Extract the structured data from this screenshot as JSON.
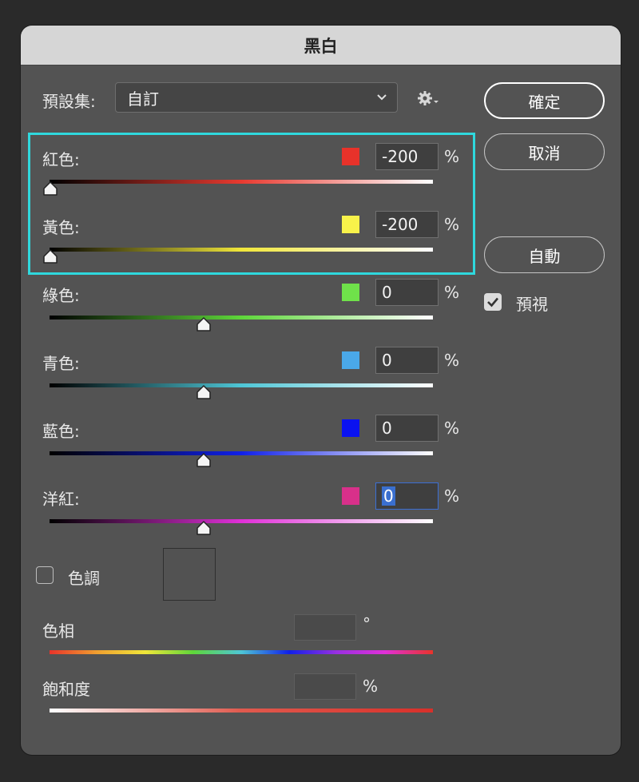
{
  "dialog": {
    "title": "黑白"
  },
  "preset": {
    "label": "預設集:",
    "value": "自訂"
  },
  "buttons": {
    "ok": "確定",
    "cancel": "取消",
    "auto": "自動"
  },
  "preview": {
    "label": "預視",
    "checked": true
  },
  "sliders": [
    {
      "label": "紅色:",
      "value": "-200",
      "unit": "%",
      "swatch": "#e8322a",
      "gradient": [
        "#000000",
        "#e83a30",
        "#ffffff"
      ],
      "level": 0.0
    },
    {
      "label": "黃色:",
      "value": "-200",
      "unit": "%",
      "swatch": "#f8f24a",
      "gradient": [
        "#000000",
        "#f0e63a",
        "#ffffff"
      ],
      "level": 0.0
    },
    {
      "label": "綠色:",
      "value": "0",
      "unit": "%",
      "swatch": "#6fe24a",
      "gradient": [
        "#000000",
        "#5ed63a",
        "#ffffff"
      ],
      "level": 0.4
    },
    {
      "label": "青色:",
      "value": "0",
      "unit": "%",
      "swatch": "#4aa8e8",
      "gradient": [
        "#000000",
        "#4ec6d6",
        "#ffffff"
      ],
      "level": 0.4
    },
    {
      "label": "藍色:",
      "value": "0",
      "unit": "%",
      "swatch": "#0a12f0",
      "gradient": [
        "#000000",
        "#1020e8",
        "#ffffff"
      ],
      "level": 0.4
    },
    {
      "label": "洋紅:",
      "value": "0",
      "unit": "%",
      "swatch": "#d8308a",
      "gradient": [
        "#000000",
        "#e030d8",
        "#ffffff"
      ],
      "level": 0.4
    }
  ],
  "tint": {
    "label": "色調",
    "checked": false
  },
  "hue": {
    "label": "色相",
    "unit": "°"
  },
  "saturation": {
    "label": "飽和度",
    "unit": "%"
  },
  "colors": {
    "highlight": "#2fd8dd",
    "focus": "#3b6fd4"
  }
}
